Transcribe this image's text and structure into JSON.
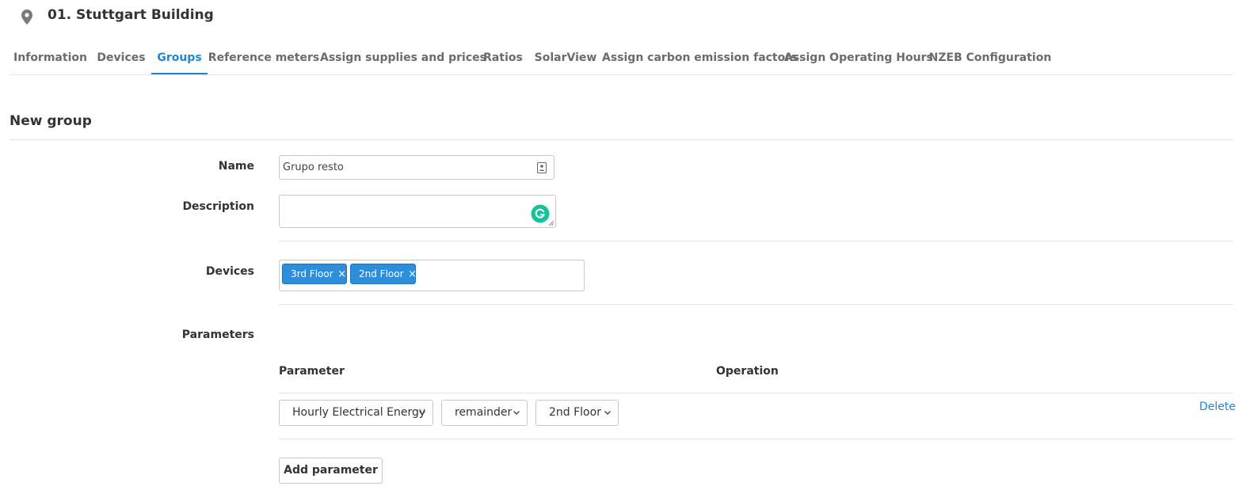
{
  "header": {
    "icon": "location-pin-icon",
    "title": "01. Stuttgart Building"
  },
  "tabs": [
    {
      "label": "Information"
    },
    {
      "label": "Devices"
    },
    {
      "label": "Groups",
      "active": true
    },
    {
      "label": "Reference meters"
    },
    {
      "label": "Assign supplies and prices"
    },
    {
      "label": "Ratios"
    },
    {
      "label": "SolarView"
    },
    {
      "label": "Assign carbon emission factors"
    },
    {
      "label": "Assign Operating Hours"
    },
    {
      "label": "NZEB Configuration"
    }
  ],
  "form": {
    "section_title": "New group",
    "name_label": "Name",
    "name_value": "Grupo resto",
    "description_label": "Description",
    "description_value": "",
    "devices_label": "Devices",
    "devices_tags": [
      {
        "label": "3rd Floor",
        "remove": "×"
      },
      {
        "label": "2nd Floor",
        "remove": "×"
      }
    ],
    "parameters_label": "Parameters"
  },
  "parameters_table": {
    "headers": {
      "parameter": "Parameter",
      "operation": "Operation"
    },
    "rows": [
      {
        "parameter": "Hourly Electrical Energy",
        "operation": "remainder",
        "device": "2nd Floor",
        "delete_label": "Delete"
      }
    ],
    "add_button": "Add parameter"
  },
  "colors": {
    "accent": "#1a8ad8",
    "tag_bg": "#2d8fdc",
    "grammarly": "#15c39a"
  }
}
